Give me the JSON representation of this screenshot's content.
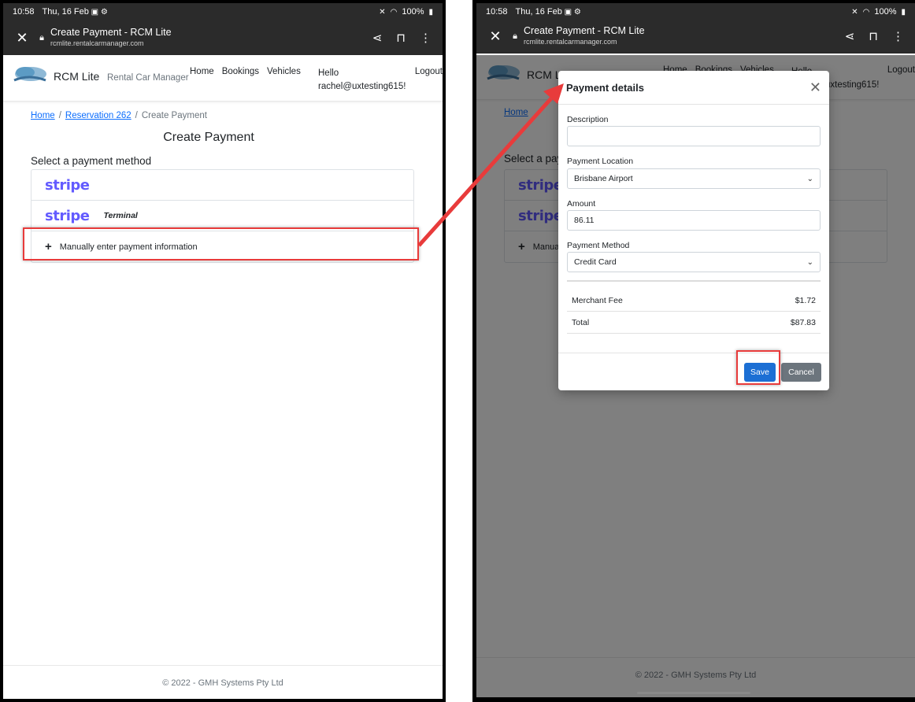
{
  "status_bar": {
    "time": "10:58",
    "date": "Thu, 16 Feb",
    "battery": "100%"
  },
  "browser": {
    "page_title": "Create Payment - RCM Lite",
    "url": "rcmlite.rentalcarmanager.com"
  },
  "navbar": {
    "brand": "RCM Lite",
    "brand_sub": "Rental Car Manager",
    "logo_text": "Rental Car Manager",
    "links": [
      "Home",
      "Bookings",
      "Vehicles"
    ],
    "hello": "Hello",
    "user": "rachel@uxtesting615!",
    "logout": "Logout"
  },
  "breadcrumb": {
    "home": "Home",
    "reservation": "Reservation 262",
    "current": "Create Payment"
  },
  "page": {
    "title": "Create Payment",
    "section_title": "Select a payment method",
    "stripe_label": "stripe",
    "terminal_label": "Terminal",
    "manual_label": "Manually enter payment information"
  },
  "footer": {
    "text": "© 2022 - GMH Systems Pty Ltd"
  },
  "modal": {
    "title": "Payment details",
    "description_label": "Description",
    "description_value": "",
    "location_label": "Payment Location",
    "location_value": "Brisbane Airport",
    "amount_label": "Amount",
    "amount_value": "86.11",
    "method_label": "Payment Method",
    "method_value": "Credit Card",
    "merchant_fee_label": "Merchant Fee",
    "merchant_fee_value": "$1.72",
    "total_label": "Total",
    "total_value": "$87.83",
    "save_label": "Save",
    "cancel_label": "Cancel"
  },
  "colors": {
    "highlight": "#e83b3b",
    "stripe": "#635bff",
    "primary": "#1c6fd4",
    "secondary": "#6c757d",
    "chrome": "#2b2b2b"
  }
}
